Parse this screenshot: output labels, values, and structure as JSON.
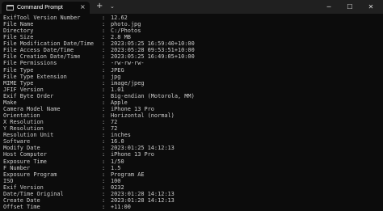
{
  "window": {
    "tab_title": "Command Prompt",
    "tab_close": "×",
    "new_tab": "+",
    "tab_dropdown": "⌄",
    "minimize": "─",
    "maximize": "☐",
    "close": "✕"
  },
  "terminal": {
    "separator": ":",
    "lines": [
      {
        "tag": "ExifTool Version Number",
        "value": "12.62"
      },
      {
        "tag": "File Name",
        "value": "photo.jpg"
      },
      {
        "tag": "Directory",
        "value": "C:/Photos"
      },
      {
        "tag": "File Size",
        "value": "2.8 MB"
      },
      {
        "tag": "File Modification Date/Time",
        "value": "2023:05:25 16:59:40+10:00"
      },
      {
        "tag": "File Access Date/Time",
        "value": "2023:05:28 09:53:51+10:00"
      },
      {
        "tag": "File Creation Date/Time",
        "value": "2023:05:25 16:49:05+10:00"
      },
      {
        "tag": "File Permissions",
        "value": "-rw-rw-rw-"
      },
      {
        "tag": "File Type",
        "value": "JPEG"
      },
      {
        "tag": "File Type Extension",
        "value": "jpg"
      },
      {
        "tag": "MIME Type",
        "value": "image/jpeg"
      },
      {
        "tag": "JFIF Version",
        "value": "1.01"
      },
      {
        "tag": "Exif Byte Order",
        "value": "Big-endian (Motorola, MM)"
      },
      {
        "tag": "Make",
        "value": "Apple"
      },
      {
        "tag": "Camera Model Name",
        "value": "iPhone 13 Pro"
      },
      {
        "tag": "Orientation",
        "value": "Horizontal (normal)"
      },
      {
        "tag": "X Resolution",
        "value": "72"
      },
      {
        "tag": "Y Resolution",
        "value": "72"
      },
      {
        "tag": "Resolution Unit",
        "value": "inches"
      },
      {
        "tag": "Software",
        "value": "16.0"
      },
      {
        "tag": "Modify Date",
        "value": "2023:01:25 14:12:13"
      },
      {
        "tag": "Host Computer",
        "value": "iPhone 13 Pro"
      },
      {
        "tag": "Exposure Time",
        "value": "1/50"
      },
      {
        "tag": "F Number",
        "value": "1.5"
      },
      {
        "tag": "Exposure Program",
        "value": "Program AE"
      },
      {
        "tag": "ISO",
        "value": "100"
      },
      {
        "tag": "Exif Version",
        "value": "0232"
      },
      {
        "tag": "Date/Time Original",
        "value": "2023:01:28 14:12:13"
      },
      {
        "tag": "Create Date",
        "value": "2023:01:28 14:12:13"
      },
      {
        "tag": "Offset Time",
        "value": "+11:00"
      }
    ]
  }
}
